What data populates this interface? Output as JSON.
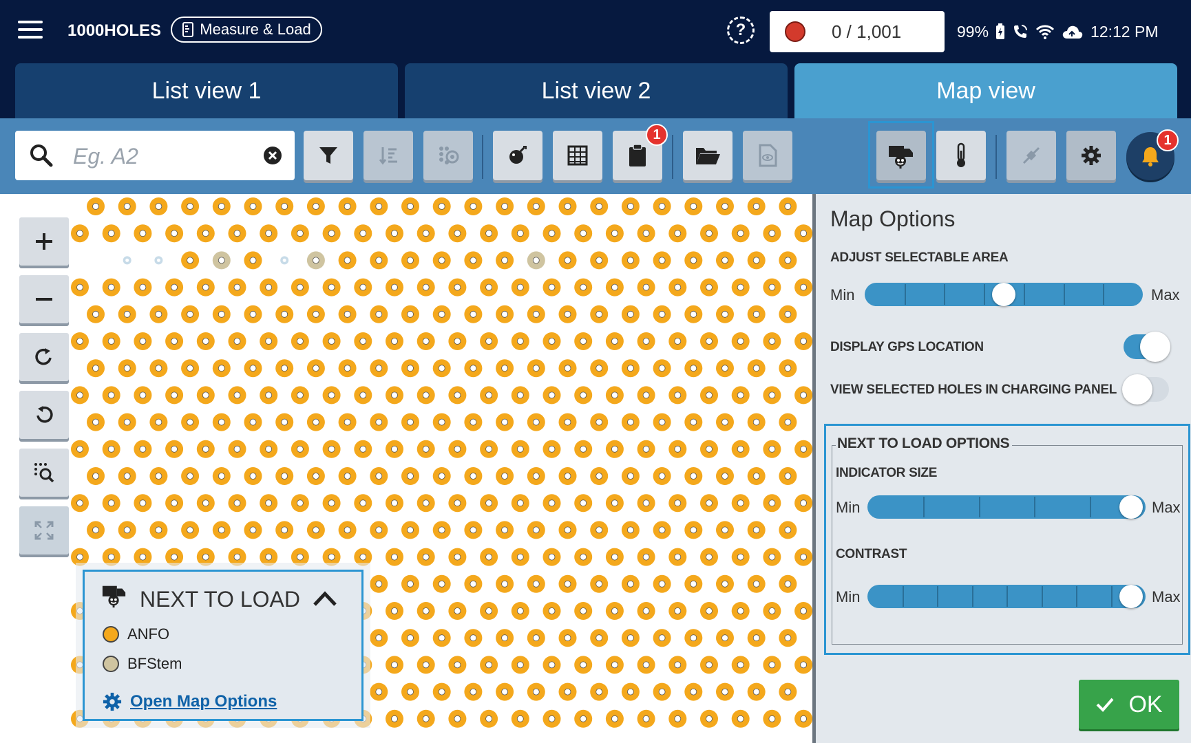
{
  "header": {
    "app_title": "1000HOLES",
    "mode_chip": "Measure & Load",
    "counter": "0 / 1,001",
    "battery": "99%",
    "time": "12:12 PM"
  },
  "tabs": [
    {
      "label": "List view 1",
      "active": false
    },
    {
      "label": "List view 2",
      "active": false
    },
    {
      "label": "Map view",
      "active": true
    }
  ],
  "search": {
    "placeholder": "Eg. A2",
    "value": ""
  },
  "toolbar": {
    "buttons": [
      {
        "name": "filter-icon"
      },
      {
        "name": "sort-icon",
        "disabled": true
      },
      {
        "name": "pattern-icon",
        "disabled": true
      },
      {
        "name": "detonator-icon"
      },
      {
        "name": "grid-icon"
      },
      {
        "name": "clipboard-icon",
        "badge": "1"
      },
      {
        "name": "folder-open-icon"
      },
      {
        "name": "document-view-icon",
        "disabled": true
      },
      {
        "name": "truck-icon",
        "selected": true
      },
      {
        "name": "thermometer-icon"
      },
      {
        "name": "connector-icon",
        "disabled": true
      },
      {
        "name": "gear-icon"
      },
      {
        "name": "bell-icon",
        "badge": "1"
      }
    ]
  },
  "colors": {
    "anfo": "#f4a81c",
    "bfstem": "#cfc4a0",
    "accent": "#2b95d2",
    "ok": "#37a34a"
  },
  "legend": {
    "title": "NEXT TO LOAD",
    "items": [
      {
        "label": "ANFO",
        "color": "#f4a81c"
      },
      {
        "label": "BFStem",
        "color": "#cfc4a0"
      }
    ],
    "link": "Open Map Options"
  },
  "map_options": {
    "title": "Map Options",
    "selectable_area": {
      "label": "ADJUST SELECTABLE AREA",
      "min": "Min",
      "max": "Max",
      "value": 0.5
    },
    "gps": {
      "label": "DISPLAY GPS LOCATION",
      "on": true
    },
    "charging_panel": {
      "label": "VIEW SELECTED HOLES IN CHARGING PANEL",
      "on": false
    },
    "next_to_load": {
      "title": "NEXT TO LOAD OPTIONS",
      "indicator_size": {
        "label": "INDICATOR SIZE",
        "min": "Min",
        "max": "Max",
        "value": 1.0
      },
      "contrast": {
        "label": "CONTRAST",
        "min": "Min",
        "max": "Max",
        "value": 1.0
      }
    },
    "ok_label": "OK"
  }
}
